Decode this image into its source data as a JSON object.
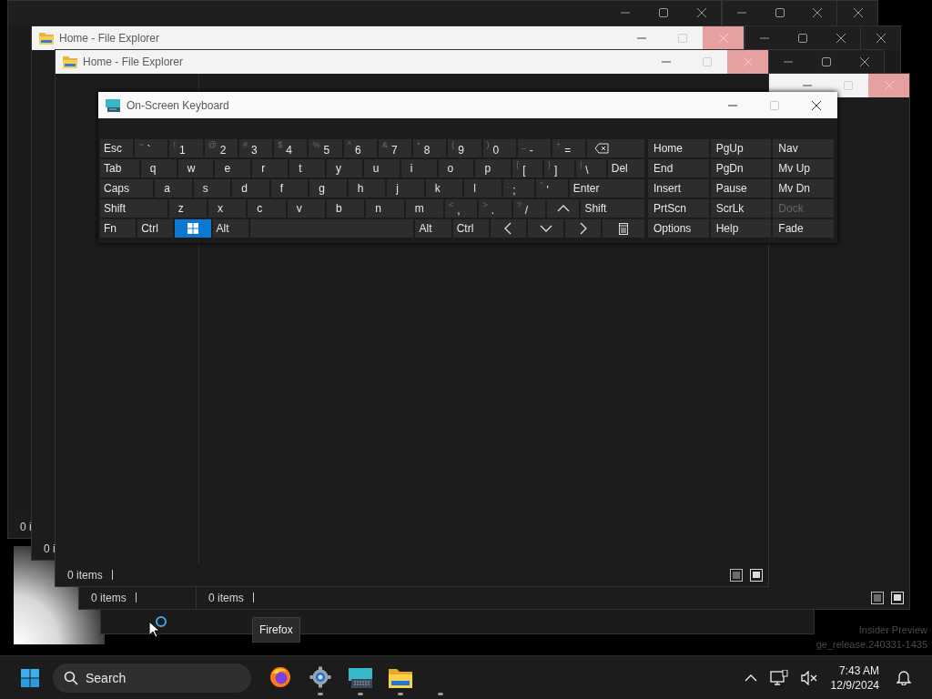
{
  "windows": [
    {
      "kind": "dark",
      "status": "0 i"
    },
    {
      "kind": "dark"
    },
    {
      "kind": "dark"
    },
    {
      "kind": "dark"
    },
    {
      "kind": "dark"
    },
    {
      "kind": "explorer",
      "title": "Home - File Explorer",
      "status": "0 i"
    },
    {
      "kind": "dark"
    },
    {
      "kind": "dark",
      "status": "0 items"
    },
    {
      "kind": "explorer",
      "status": "0 items"
    },
    {
      "kind": "explorer",
      "title": "Home - File Explorer",
      "status": "0 items"
    }
  ],
  "keyboard": {
    "title": "On-Screen Keyboard",
    "rows": [
      [
        {
          "kind": "label",
          "label": "Esc",
          "on": false
        },
        {
          "kind": "char",
          "shift": "~",
          "label": "`",
          "on": false
        },
        {
          "kind": "char",
          "shift": "!",
          "label": "1",
          "on": false
        },
        {
          "kind": "char",
          "shift": "@",
          "label": "2",
          "on": false
        },
        {
          "kind": "char",
          "shift": "#",
          "label": "3",
          "on": false
        },
        {
          "kind": "char",
          "shift": "$",
          "label": "4",
          "on": false
        },
        {
          "kind": "char",
          "shift": "%",
          "label": "5",
          "on": false
        },
        {
          "kind": "char",
          "shift": "^",
          "label": "6",
          "on": false
        },
        {
          "kind": "char",
          "shift": "&",
          "label": "7",
          "on": false
        },
        {
          "kind": "char",
          "shift": "*",
          "label": "8",
          "on": false
        },
        {
          "kind": "char",
          "shift": "(",
          "label": "9",
          "on": false
        },
        {
          "kind": "char",
          "shift": ")",
          "label": "0",
          "on": false
        },
        {
          "kind": "char",
          "shift": "_",
          "label": "-",
          "on": false
        },
        {
          "kind": "char",
          "shift": "+",
          "label": "=",
          "on": false
        },
        {
          "kind": "backspace",
          "on": false
        }
      ],
      [
        {
          "kind": "label",
          "label": "Tab",
          "on": false
        },
        {
          "kind": "letter",
          "label": "q",
          "on": false
        },
        {
          "kind": "letter",
          "label": "w",
          "on": false
        },
        {
          "kind": "letter",
          "label": "e",
          "on": false
        },
        {
          "kind": "letter",
          "label": "r",
          "on": false
        },
        {
          "kind": "letter",
          "label": "t",
          "on": false
        },
        {
          "kind": "letter",
          "label": "y",
          "on": false
        },
        {
          "kind": "letter",
          "label": "u",
          "on": false
        },
        {
          "kind": "letter",
          "label": "i",
          "on": false
        },
        {
          "kind": "letter",
          "label": "o",
          "on": false
        },
        {
          "kind": "letter",
          "label": "p",
          "on": false
        },
        {
          "kind": "char",
          "shift": "{",
          "label": "[",
          "on": false
        },
        {
          "kind": "char",
          "shift": "}",
          "label": "]",
          "on": false
        },
        {
          "kind": "char",
          "shift": "|",
          "label": "\\",
          "on": false
        },
        {
          "kind": "label",
          "label": "Del",
          "on": false
        }
      ],
      [
        {
          "kind": "label",
          "label": "Caps",
          "on": false
        },
        {
          "kind": "letter",
          "label": "a",
          "on": false
        },
        {
          "kind": "letter",
          "label": "s",
          "on": false
        },
        {
          "kind": "letter",
          "label": "d",
          "on": false
        },
        {
          "kind": "letter",
          "label": "f",
          "on": false
        },
        {
          "kind": "letter",
          "label": "g",
          "on": false
        },
        {
          "kind": "letter",
          "label": "h",
          "on": false
        },
        {
          "kind": "letter",
          "label": "j",
          "on": false
        },
        {
          "kind": "letter",
          "label": "k",
          "on": false
        },
        {
          "kind": "letter",
          "label": "l",
          "on": false
        },
        {
          "kind": "char",
          "shift": ":",
          "label": ";",
          "on": false
        },
        {
          "kind": "char",
          "shift": "\"",
          "label": "'",
          "on": false
        },
        {
          "kind": "label",
          "label": "Enter",
          "on": false
        }
      ],
      [
        {
          "kind": "label",
          "label": "Shift",
          "on": false
        },
        {
          "kind": "letter",
          "label": "z",
          "on": false
        },
        {
          "kind": "letter",
          "label": "x",
          "on": false
        },
        {
          "kind": "letter",
          "label": "c",
          "on": false
        },
        {
          "kind": "letter",
          "label": "v",
          "on": false
        },
        {
          "kind": "letter",
          "label": "b",
          "on": false
        },
        {
          "kind": "letter",
          "label": "n",
          "on": false
        },
        {
          "kind": "letter",
          "label": "m",
          "on": false
        },
        {
          "kind": "char",
          "shift": "<",
          "label": ",",
          "on": false
        },
        {
          "kind": "char",
          "shift": ">",
          "label": ".",
          "on": false
        },
        {
          "kind": "char",
          "shift": "?",
          "label": "/",
          "on": false
        },
        {
          "kind": "up",
          "on": false
        },
        {
          "kind": "label",
          "label": "Shift",
          "on": false
        }
      ],
      [
        {
          "kind": "label",
          "label": "Fn",
          "on": false
        },
        {
          "kind": "label",
          "label": "Ctrl",
          "on": false
        },
        {
          "kind": "win",
          "on": true
        },
        {
          "kind": "label",
          "label": "Alt",
          "on": false
        },
        {
          "kind": "space",
          "on": false
        },
        {
          "kind": "label",
          "label": "Alt",
          "on": false
        },
        {
          "kind": "label",
          "label": "Ctrl",
          "on": false
        },
        {
          "kind": "left",
          "on": false
        },
        {
          "kind": "down",
          "on": false
        },
        {
          "kind": "right",
          "on": false
        },
        {
          "kind": "menu",
          "on": false
        }
      ]
    ],
    "side_rows": [
      [
        {
          "label": "Home",
          "disabled": false
        },
        {
          "label": "PgUp",
          "disabled": false
        },
        {
          "label": "Nav",
          "disabled": false
        }
      ],
      [
        {
          "label": "End",
          "disabled": false
        },
        {
          "label": "PgDn",
          "disabled": false
        },
        {
          "label": "Mv Up",
          "disabled": false
        }
      ],
      [
        {
          "label": "Insert",
          "disabled": false
        },
        {
          "label": "Pause",
          "disabled": false
        },
        {
          "label": "Mv Dn",
          "disabled": false
        }
      ],
      [
        {
          "label": "PrtScn",
          "disabled": false
        },
        {
          "label": "ScrLk",
          "disabled": false
        },
        {
          "label": "Dock",
          "disabled": true
        }
      ],
      [
        {
          "label": "Options",
          "disabled": false
        },
        {
          "label": "Help",
          "disabled": false
        },
        {
          "label": "Fade",
          "disabled": false
        }
      ]
    ]
  },
  "tooltip": "Firefox",
  "watermark": [
    "Insider Preview",
    "ge_release.240331-1435"
  ],
  "taskbar": {
    "search": {
      "placeholder": "Search"
    },
    "apps": [
      {
        "kind": "browser",
        "running": false
      },
      {
        "kind": "settings",
        "running": true
      },
      {
        "kind": "keyboard",
        "running": true
      },
      {
        "kind": "folder",
        "running": true
      },
      {
        "kind": "blank",
        "running": true
      }
    ],
    "clock": {
      "time": "7:43 AM",
      "date": "12/9/2024"
    }
  }
}
